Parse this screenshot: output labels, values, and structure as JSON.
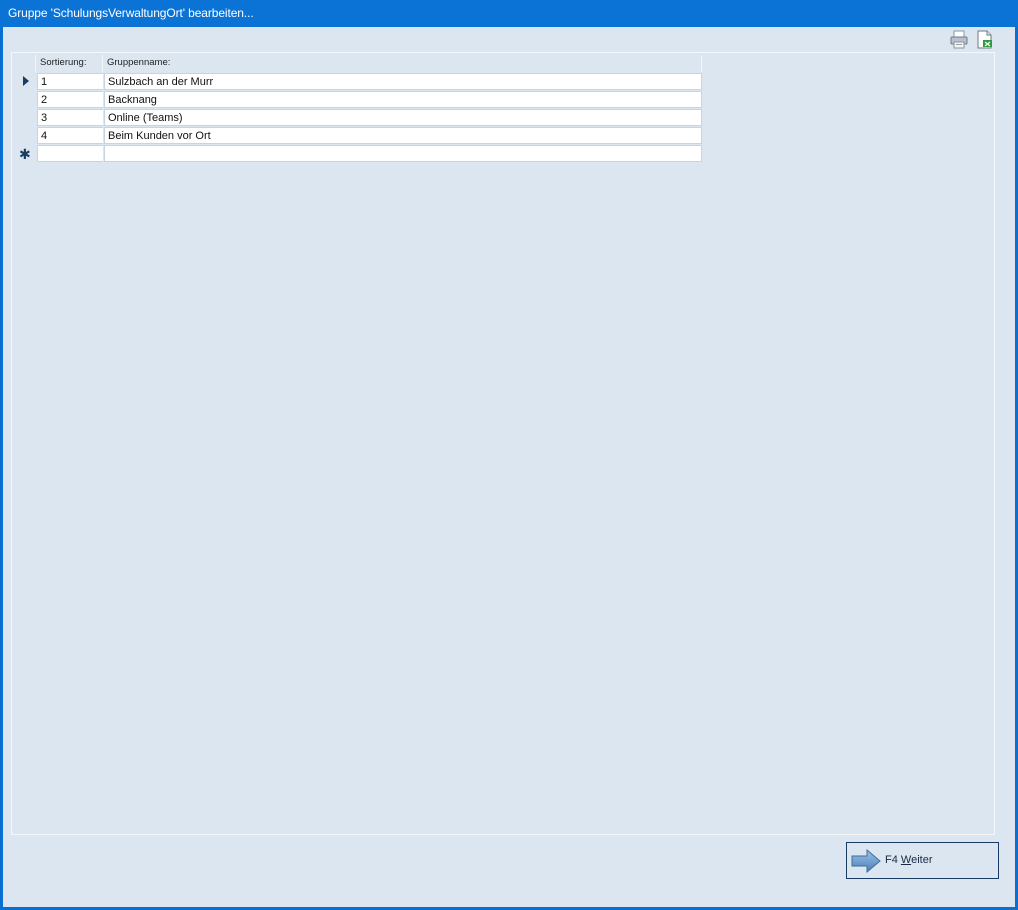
{
  "window": {
    "title": "Gruppe 'SchulungsVerwaltungOrt' bearbeiten..."
  },
  "toolbar": {
    "icons": [
      "printer-icon",
      "export-icon"
    ]
  },
  "grid": {
    "columns": [
      "Sortierung:",
      "Gruppenname:"
    ],
    "rows": [
      {
        "sort": "1",
        "name": "Sulzbach an der Murr"
      },
      {
        "sort": "2",
        "name": "Backnang"
      },
      {
        "sort": "3",
        "name": "Online (Teams)"
      },
      {
        "sort": "4",
        "name": "Beim Kunden vor Ort"
      }
    ],
    "new_row_marker": "✱"
  },
  "buttons": {
    "next_key": "F4",
    "next_mnemonic": "W",
    "next_rest": "eiter"
  },
  "colors": {
    "titlebar": "#0b73d6",
    "background": "#dce6f0",
    "accent": "#1a3a66"
  }
}
